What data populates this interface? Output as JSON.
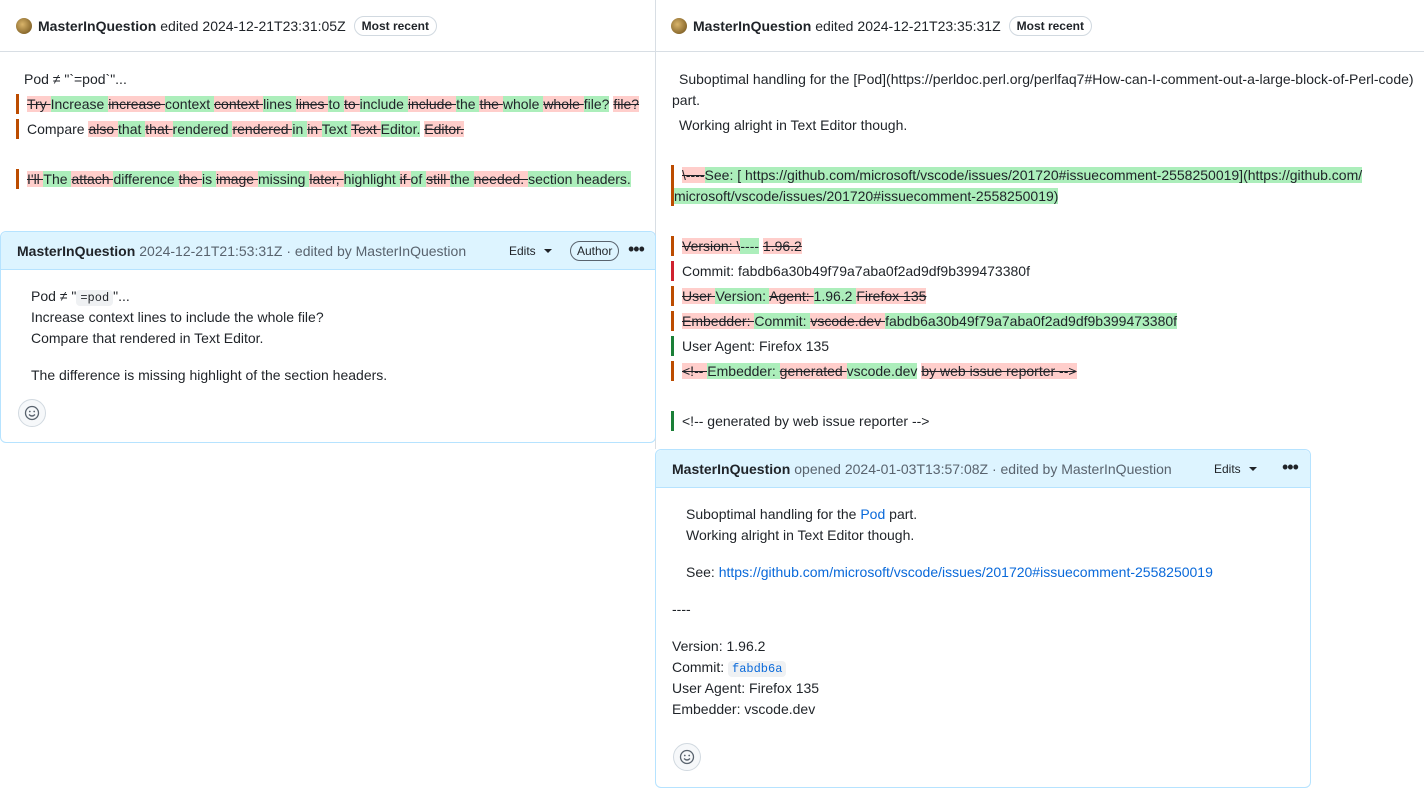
{
  "left_pane": {
    "header": {
      "user": "MasterInQuestion",
      "action": "edited",
      "timestamp": "2024-12-21T23:31:05Z",
      "badge": "Most recent"
    },
    "title_line": "Pod ≠ \"`=pod`\"...",
    "line1": {
      "d1": "Try ",
      "a1": "Increase ",
      "d2": "increase ",
      "a2": "context ",
      "d3": "context ",
      "a3": "lines ",
      "d4": "lines ",
      "a4": "to ",
      "d5": "to ",
      "a5": "include ",
      "d6": "include ",
      "a6": "the ",
      "d7": "the ",
      "a7": "whole ",
      "d8": "whole ",
      "a8": "file?",
      "sp": " ",
      "d9": "file?"
    },
    "line2": {
      "t1": "Compare ",
      "d1": "also ",
      "a1": "that ",
      "d2": "that ",
      "a2": "rendered ",
      "d3": "rendered ",
      "a3": "in ",
      "d4": "in ",
      "a4": "Text ",
      "d5": "Text ",
      "a5": "Editor.",
      "sp": " ",
      "d6": "Editor."
    },
    "line3": {
      "d1": "I'll ",
      "a1": "The ",
      "d2": "attach ",
      "a2": "difference ",
      "d3": "the ",
      "a3": "is ",
      "d4": "image ",
      "a4": "missing ",
      "d5": "later, ",
      "a5": "highlight ",
      "d6": "if ",
      "a6": "of ",
      "d7": "still ",
      "a7": "the ",
      "d8": "needed. ",
      "a8": "section headers."
    }
  },
  "left_comment": {
    "user": "MasterInQuestion",
    "meta": "2024-12-21T21:53:31Z · edited by MasterInQuestion",
    "edits": "Edits",
    "author": "Author",
    "pod_prefix": "Pod ≠ \"",
    "pod_code": "=pod",
    "pod_suffix": "\"...",
    "l2": "Increase context lines to include the whole file?",
    "l3": "Compare that rendered in Text Editor.",
    "l4": "The difference is missing highlight of the section headers."
  },
  "right_pane": {
    "header": {
      "user": "MasterInQuestion",
      "action": "edited",
      "timestamp": "2024-12-21T23:35:31Z",
      "badge": "Most recent"
    },
    "p1a": "Suboptimal handling for the [Pod](https://perldoc.perl.org/perlfaq7#How-can-I-comment-out-a-large-block-of-Perl-code)",
    "p1b": "part.",
    "p2": "Working alright in Text Editor though.",
    "see": {
      "d1": "\\----",
      "a1": "See: [ https://github.com/microsoft/vscode/issues/201720#issuecomment-2558250019](https://github.com/",
      "a2": "microsoft/vscode/issues/201720#issuecomment-2558250019)"
    },
    "ver": {
      "d1": "Version: \\",
      "a1": "----",
      "sp": " ",
      "d2": "1.96.2"
    },
    "commit": "Commit: fabdb6a30b49f79a7aba0f2ad9df9b399473380f",
    "ua": {
      "d1": "User ",
      "a1": "Version: ",
      "d2": "Agent: ",
      "t1": "1.96.2 ",
      "d3": "Firefox 135"
    },
    "emb": {
      "d1": "Embedder: ",
      "a1": "Commit: ",
      "d2": "vscode.dev ",
      "a2": "fabdb6a30b49f79a7aba0f2ad9df9b399473380f"
    },
    "ua2": "User Agent: Firefox 135",
    "gen": {
      "d1": "<!-- ",
      "a1": "Embedder: ",
      "d2": "generated ",
      "a2": "vscode.dev",
      "sp": " ",
      "d3": "by web issue reporter -->"
    },
    "gen2": "<!-- generated by web issue reporter -->"
  },
  "right_comment": {
    "user": "MasterInQuestion",
    "meta": "opened 2024-01-03T13:57:08Z · edited by MasterInQuestion",
    "edits": "Edits",
    "l1a": "Suboptimal handling for the ",
    "l1link": "Pod",
    "l1b": " part.",
    "l2": "Working alright in Text Editor though.",
    "see_label": "See: ",
    "see_link": "https://github.com/microsoft/vscode/issues/201720#issuecomment-2558250019",
    "hr": "----",
    "version": "Version: 1.96.2",
    "commit_label": "Commit: ",
    "commit_code": "fabdb6a",
    "ua": "User Agent: Firefox 135",
    "emb": "Embedder: vscode.dev"
  }
}
